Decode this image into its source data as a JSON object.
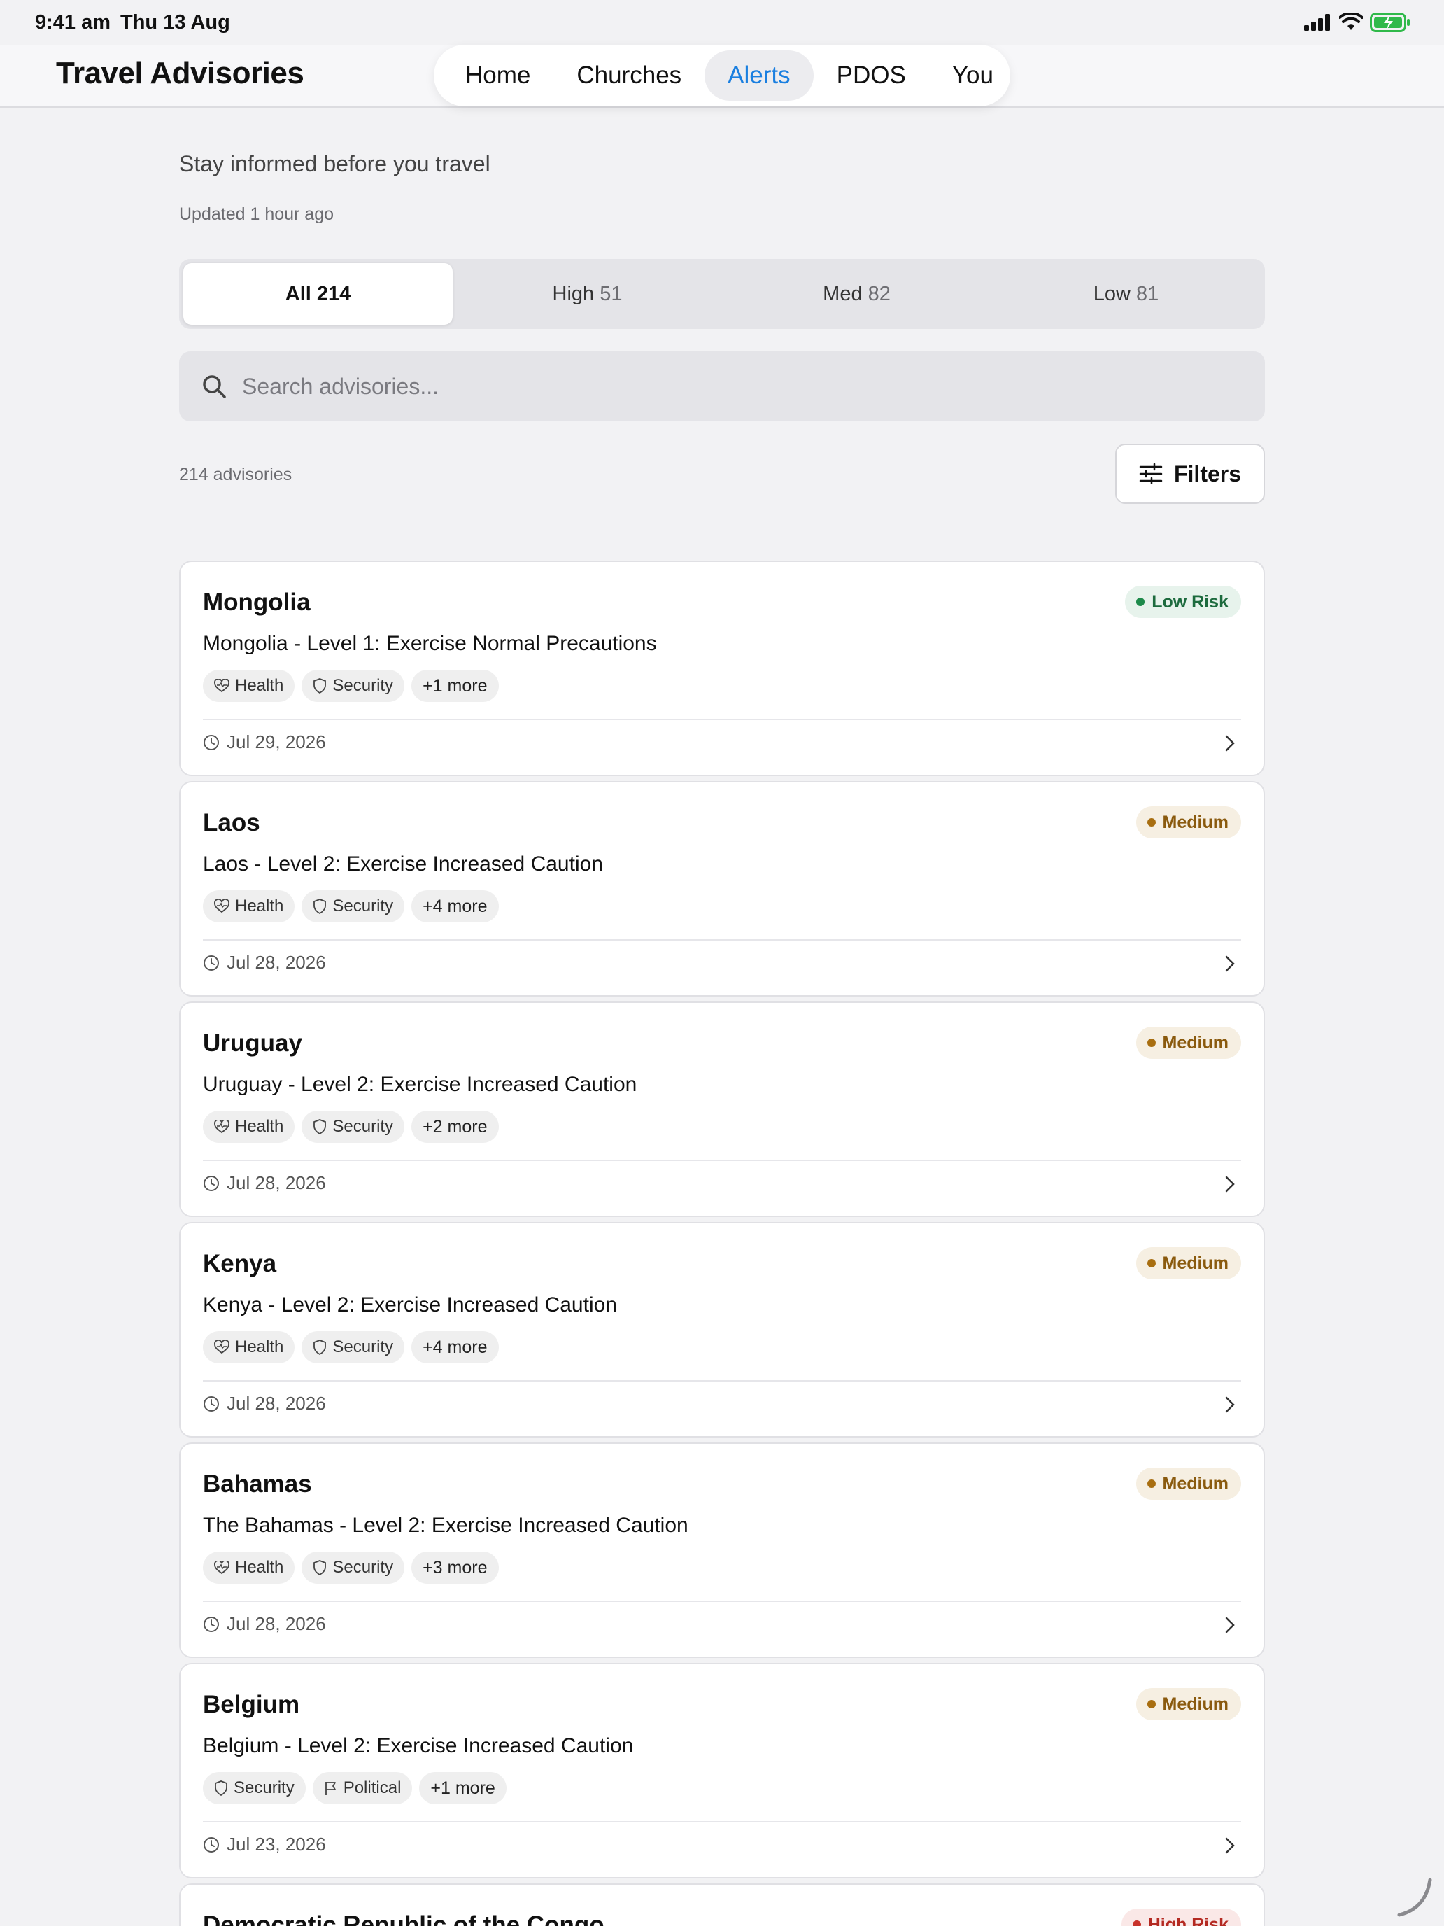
{
  "status_bar": {
    "time": "9:41 am",
    "date": "Thu 13 Aug"
  },
  "header": {
    "title": "Travel Advisories",
    "nav": [
      {
        "label": "Home",
        "active": false
      },
      {
        "label": "Churches",
        "active": false
      },
      {
        "label": "Alerts",
        "active": true
      },
      {
        "label": "PDOS",
        "active": false
      },
      {
        "label": "You",
        "active": false
      }
    ]
  },
  "intro": {
    "subtitle": "Stay informed before you travel",
    "updated": "Updated 1 hour ago"
  },
  "segments": [
    {
      "label": "All",
      "count": "214",
      "active": true
    },
    {
      "label": "High",
      "count": "51",
      "active": false
    },
    {
      "label": "Med",
      "count": "82",
      "active": false
    },
    {
      "label": "Low",
      "count": "81",
      "active": false
    }
  ],
  "search": {
    "placeholder": "Search advisories..."
  },
  "results": {
    "count_label": "214 advisories",
    "filters_label": "Filters"
  },
  "colors": {
    "accent": "#1a7fe0",
    "low": "#1d8a4a",
    "medium": "#a86e10",
    "high": "#c8332b"
  },
  "advisories": [
    {
      "country": "Mongolia",
      "risk": "Low Risk",
      "level": "low",
      "headline": "Mongolia - Level 1: Exercise Normal Precautions",
      "tags": [
        {
          "label": "Health",
          "icon": "heart-pulse-icon"
        },
        {
          "label": "Security",
          "icon": "shield-icon"
        }
      ],
      "more": "+1 more",
      "date": "Jul 29, 2026"
    },
    {
      "country": "Laos",
      "risk": "Medium",
      "level": "med",
      "headline": "Laos - Level 2: Exercise Increased Caution",
      "tags": [
        {
          "label": "Health",
          "icon": "heart-pulse-icon"
        },
        {
          "label": "Security",
          "icon": "shield-icon"
        }
      ],
      "more": "+4 more",
      "date": "Jul 28, 2026"
    },
    {
      "country": "Uruguay",
      "risk": "Medium",
      "level": "med",
      "headline": "Uruguay - Level 2: Exercise Increased Caution",
      "tags": [
        {
          "label": "Health",
          "icon": "heart-pulse-icon"
        },
        {
          "label": "Security",
          "icon": "shield-icon"
        }
      ],
      "more": "+2 more",
      "date": "Jul 28, 2026"
    },
    {
      "country": "Kenya",
      "risk": "Medium",
      "level": "med",
      "headline": "Kenya - Level 2: Exercise Increased Caution",
      "tags": [
        {
          "label": "Health",
          "icon": "heart-pulse-icon"
        },
        {
          "label": "Security",
          "icon": "shield-icon"
        }
      ],
      "more": "+4 more",
      "date": "Jul 28, 2026"
    },
    {
      "country": "Bahamas",
      "risk": "Medium",
      "level": "med",
      "headline": "The Bahamas - Level 2: Exercise Increased Caution",
      "tags": [
        {
          "label": "Health",
          "icon": "heart-pulse-icon"
        },
        {
          "label": "Security",
          "icon": "shield-icon"
        }
      ],
      "more": "+3 more",
      "date": "Jul 28, 2026"
    },
    {
      "country": "Belgium",
      "risk": "Medium",
      "level": "med",
      "headline": "Belgium - Level 2: Exercise Increased Caution",
      "tags": [
        {
          "label": "Security",
          "icon": "shield-icon"
        },
        {
          "label": "Political",
          "icon": "flag-icon"
        }
      ],
      "more": "+1 more",
      "date": "Jul 23, 2026"
    },
    {
      "country": "Democratic Republic of the Congo",
      "risk": "High Risk",
      "level": "high",
      "headline": "",
      "tags": [],
      "more": "",
      "date": ""
    }
  ]
}
